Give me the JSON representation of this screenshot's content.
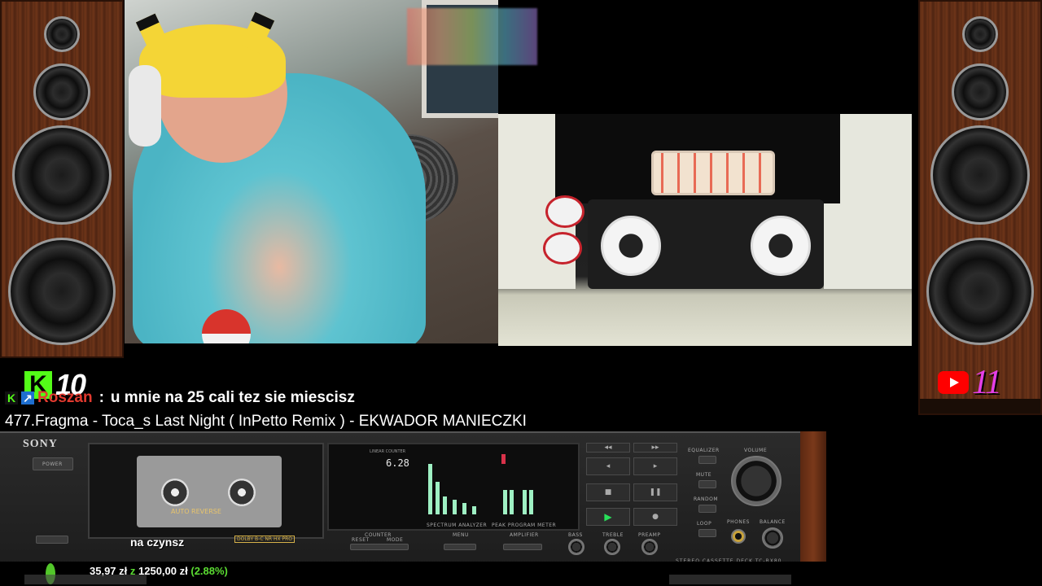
{
  "badges": {
    "kick": {
      "icon": "kick-logo-icon",
      "letter": "K",
      "count": "10",
      "color": "#53fc18"
    },
    "youtube": {
      "icon": "youtube-logo-icon",
      "count": "11",
      "color": "#ff0000"
    }
  },
  "chat": {
    "user": "Roszan",
    "separator": ":",
    "message": "u mnie na 25 cali tez sie miescisz",
    "user_color": "#e23a2f"
  },
  "now_playing": "477.Fragma - Toca_s Last Night ( InPetto Remix ) - EKWADOR MANIECZKI",
  "deck": {
    "brand": "SONY",
    "power_label": "POWER",
    "auto_reverse": "AUTO REVERSE",
    "counter_label": "LINEAR COUNTER",
    "counter_value": "6.28",
    "spectrum_label": "SPECTRUM ANALYZER",
    "peak_label": "PEAK PROGRAM METER",
    "caption": "na czynsz",
    "dolby": "DOLBY B-C NR HX PRO",
    "labels": [
      "COUNTER",
      "RESET",
      "MODE",
      "MENU",
      "AMPLIFIER",
      "BASS",
      "TREBLE",
      "PREAMP",
      "EQUALIZER",
      "MUTE",
      "RANDOM",
      "LOOP",
      "VOLUME",
      "PHONES",
      "BALANCE"
    ],
    "model": "STEREO CASSETTE DECK TC-RX80",
    "transport_symbols": [
      "◂◂",
      "▸▸",
      "◂",
      "▸",
      "■",
      "❚❚",
      "▶",
      "●"
    ]
  },
  "donation": {
    "current": "35,97 zł",
    "separator": "z",
    "goal": "1250,00 zł",
    "percent": "(2.88%)",
    "progress": 0.0288,
    "color": "#5bdc32"
  }
}
